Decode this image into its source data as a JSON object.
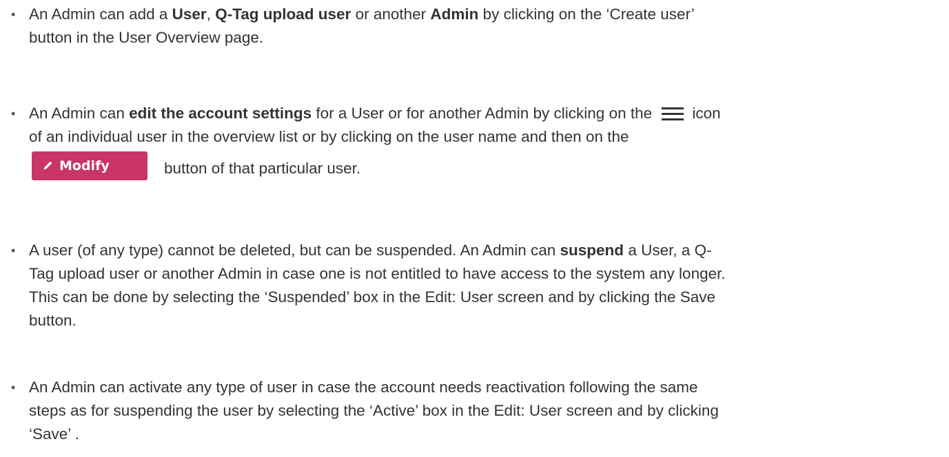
{
  "items": [
    {
      "p1": "An Admin can add a ",
      "b1": "User",
      "p2": ", ",
      "b2": "Q-Tag upload user",
      "p3": " or another ",
      "b3": "Admin",
      "p4": " by clicking on the ‘Create user’",
      "line2": "button in the User Overview page."
    },
    {
      "p1": "An Admin can ",
      "b1": "edit the account settings",
      "p2": " for a User or for another Admin by clicking on the ",
      "p3": "icon",
      "line2": "of an individual user in the overview list or by clicking on the user name and then on the",
      "button_label": "Modify",
      "after_button": "button of that particular user."
    },
    {
      "p1": "A user (of any type) cannot be deleted, but can be suspended. An Admin can ",
      "b1": "suspend",
      "p2": " a User, a Q-",
      "line2": "Tag upload user or another Admin in case one is not entitled to have access to the system any longer.",
      "line3": "This can be done by selecting the ‘Suspended’ box in the Edit: User screen and by clicking the Save",
      "line4": "button."
    },
    {
      "line1": "An Admin can activate any type of user in case the account needs reactivation following the same",
      "line2": "steps as for suspending the user by selecting the ‘Active’ box in the Edit: User screen and by clicking",
      "line3": "‘Save’ ."
    }
  ],
  "icons": {
    "bullet": "•",
    "menu": "hamburger-menu-icon",
    "pencil": "pencil-icon"
  },
  "colors": {
    "text": "#333333",
    "modify_button": "#c93568",
    "modify_text": "#ffffff"
  }
}
